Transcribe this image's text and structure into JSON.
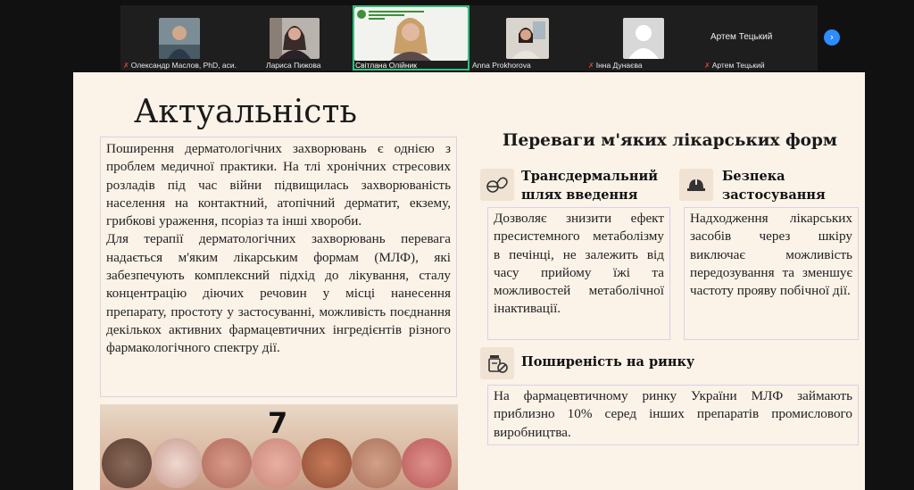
{
  "participants": [
    {
      "name": "Олександр Маслов, PhD, аси...",
      "muted": true
    },
    {
      "name": "Лариса Пижова",
      "muted": false
    },
    {
      "name": "Світлана Олійник",
      "muted": false,
      "active": true,
      "background_text": "Національний фармацевтичний університет"
    },
    {
      "name": "Anna Prokhorova",
      "muted": false
    },
    {
      "name": "Інна Дунаєва",
      "muted": true
    },
    {
      "name": "Артем Тецький",
      "muted": true,
      "video_label": "Артем Тецький"
    }
  ],
  "controls": {
    "next_icon": "chevron-right-icon",
    "next_glyph": "›"
  },
  "slide": {
    "title": "Актуальність",
    "left_text": [
      "Поширення дерматологічних захворювань є однією з проблем медичної практики. На тлі хронічних стресових розладів під час війни підвищилась захворюваність населення на контактний, атопічний дерматит, екзему, грибкові ураження, псоріаз та інші хвороби.",
      "Для терапії дерматологічних захворювань перевага надається м'яким лікарським формам (МЛФ), які забезпечують комплексний підхід до лікування, сталу концентрацію діючих речовин у місці нанесення препарату, простоту у застосуванні, можливість поєднання декількох активних фармацевтичних інгредієнтів різного фармакологічного спектру дії."
    ],
    "image_number": "7",
    "right_title": "Переваги м'яких лікарських форм",
    "sections": [
      {
        "icon": "pill-capsule-icon",
        "heading": "Трансдермальний шлях введення",
        "text": "Дозволяє знизити ефект пресистемного метаболізму в печінці, не залежить від часу прийому їжі та можливостей метаболічної інактивації."
      },
      {
        "icon": "hard-hat-icon",
        "heading": "Безпека застосування",
        "text": "Надходження лікарських засобів через шкіру виключає можливість передозування та зменшує частоту прояву побічної дії."
      },
      {
        "icon": "medicine-bottle-icon",
        "heading": "Поширеність на ринку",
        "text": "На фармацевтичному ринку України МЛФ займають приблизно 10% серед інших препаратів промислового виробництва."
      }
    ]
  },
  "colors": {
    "active_border": "#2ec27e",
    "mute_red": "#e0463c",
    "accent_blue": "#2d8cff",
    "slide_bg": "#fbf2e8"
  }
}
